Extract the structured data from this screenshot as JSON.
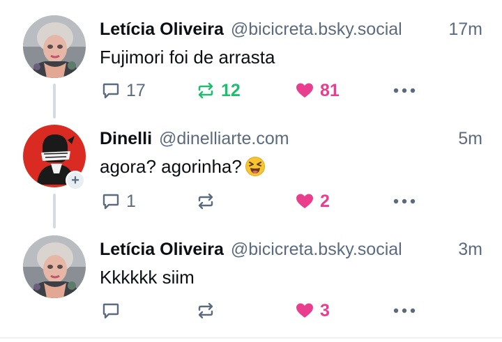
{
  "posts": [
    {
      "author_name": "Letícia Oliveira",
      "author_handle": "@bicicreta.bsky.social",
      "time": "17m",
      "text": "Fujimori foi de arrasta",
      "reply_count": "17",
      "repost_count": "12",
      "like_count": "81",
      "reposted": true,
      "liked": true
    },
    {
      "author_name": "Dinelli",
      "author_handle": "@dinelliarte.com",
      "time": "5m",
      "text": "agora? agorinha?",
      "reply_count": "1",
      "repost_count": "",
      "like_count": "2",
      "reposted": false,
      "liked": true,
      "emoji": "laughing-squinting-face-icon"
    },
    {
      "author_name": "Letícia Oliveira",
      "author_handle": "@bicicreta.bsky.social",
      "time": "3m",
      "text": "Kkkkkk siim",
      "reply_count": "",
      "repost_count": "",
      "like_count": "3",
      "reposted": false,
      "liked": true
    }
  ],
  "colors": {
    "repost_active": "#20bc6f",
    "like_active": "#e93d8e",
    "muted": "#5b6b7d",
    "thread_line": "#d4dbe2"
  }
}
